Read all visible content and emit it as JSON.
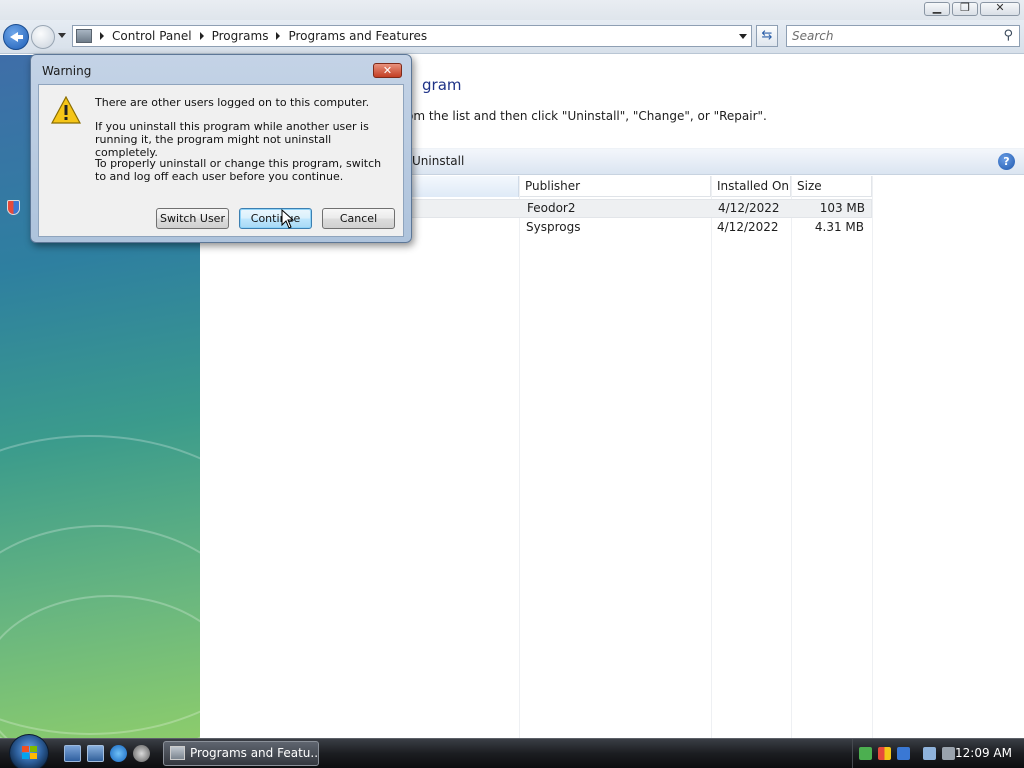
{
  "window": {
    "minimize_glyph": "▁",
    "restore_glyph": "❐",
    "close_glyph": "✕"
  },
  "address": {
    "breadcrumbs": [
      "Control Panel",
      "Programs",
      "Programs and Features"
    ],
    "search_placeholder": "Search"
  },
  "content": {
    "title_fragment": "gram",
    "subtitle_fragment": "om the list and then click \"Uninstall\", \"Change\", or \"Repair\".",
    "command_uninstall": "Uninstall",
    "help_glyph": "?",
    "columns": [
      "Publisher",
      "Installed On",
      "Size"
    ],
    "rows": [
      {
        "publisher": "Feodor2",
        "installed_on": "4/12/2022",
        "size": "103 MB"
      },
      {
        "publisher": "Sysprogs",
        "installed_on": "4/12/2022",
        "size": "4.31 MB"
      }
    ]
  },
  "dialog": {
    "title": "Warning",
    "close_glyph": "✕",
    "message_1": "There are other users logged on to this computer.",
    "message_2": "If you uninstall this program while another user is running it, the program might not uninstall completely.",
    "message_3": "To properly uninstall or change this program, switch to and log off each user before you continue.",
    "buttons": {
      "switch_user": "Switch User",
      "continue": "Continue",
      "cancel": "Cancel"
    }
  },
  "taskbar": {
    "task_label": "Programs and Featu...",
    "clock": "12:09 AM"
  },
  "colors": {
    "title_blue": "#1e3287",
    "taskbar": "#1b1d21",
    "dialog_frame": "#aec3dc"
  }
}
